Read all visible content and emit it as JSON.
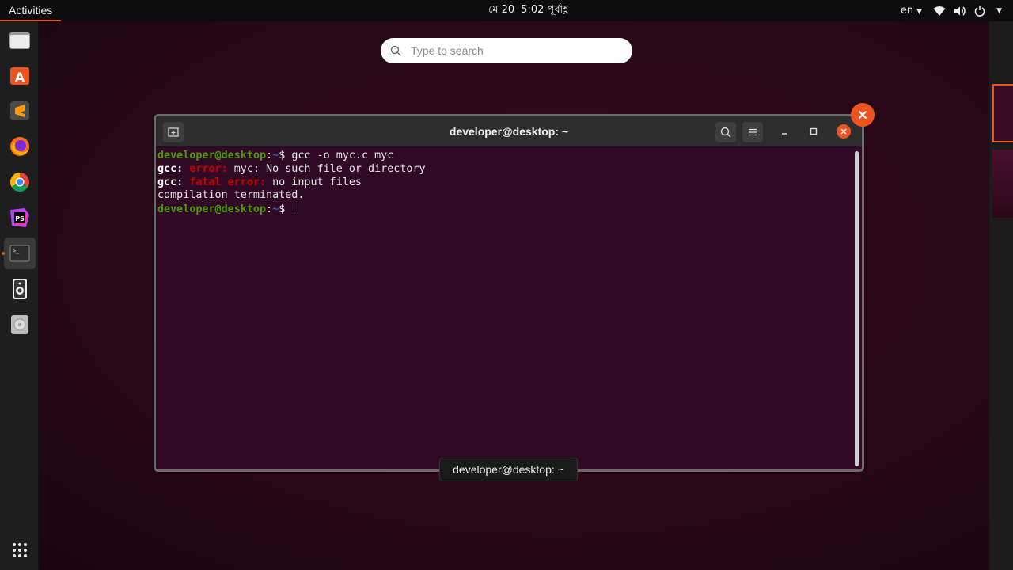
{
  "topbar": {
    "activities": "Activities",
    "date": "মে 20",
    "time": "5:02 পূর্বাহ্ণ",
    "language": "en"
  },
  "dock": {
    "items": [
      {
        "name": "files",
        "icon": "folder-icon"
      },
      {
        "name": "software",
        "icon": "software-store-icon"
      },
      {
        "name": "sublime",
        "icon": "sublime-text-icon"
      },
      {
        "name": "firefox",
        "icon": "firefox-icon"
      },
      {
        "name": "chrome",
        "icon": "chrome-icon"
      },
      {
        "name": "phpstorm",
        "icon": "phpstorm-icon",
        "label": "PS"
      },
      {
        "name": "terminal",
        "icon": "terminal-icon",
        "active": true
      },
      {
        "name": "speaker",
        "icon": "speaker-icon"
      },
      {
        "name": "disc",
        "icon": "disc-icon"
      }
    ],
    "show_apps_icon": "app-grid-icon"
  },
  "search": {
    "placeholder": "Type to search"
  },
  "window": {
    "title": "developer@desktop: ~",
    "terminal": {
      "lines": [
        {
          "prompt_user": "developer@desktop",
          "prompt_sep": ":",
          "prompt_path": "~",
          "prompt_end": "$ ",
          "command": "gcc -o myc.c myc"
        },
        {
          "prefix": "gcc: ",
          "error": "error:",
          "message": " myc: No such file or directory"
        },
        {
          "prefix": "gcc: ",
          "error": "fatal error:",
          "message": " no input files"
        },
        {
          "text": "compilation terminated."
        },
        {
          "prompt_user": "developer@desktop",
          "prompt_sep": ":",
          "prompt_path": "~",
          "prompt_end": "$ "
        }
      ]
    }
  },
  "tooltip": "developer@desktop: ~",
  "colors": {
    "accent": "#e95420",
    "terminal_bg": "#300a24",
    "prompt_user": "#4e9a06",
    "error": "#cc0000"
  }
}
